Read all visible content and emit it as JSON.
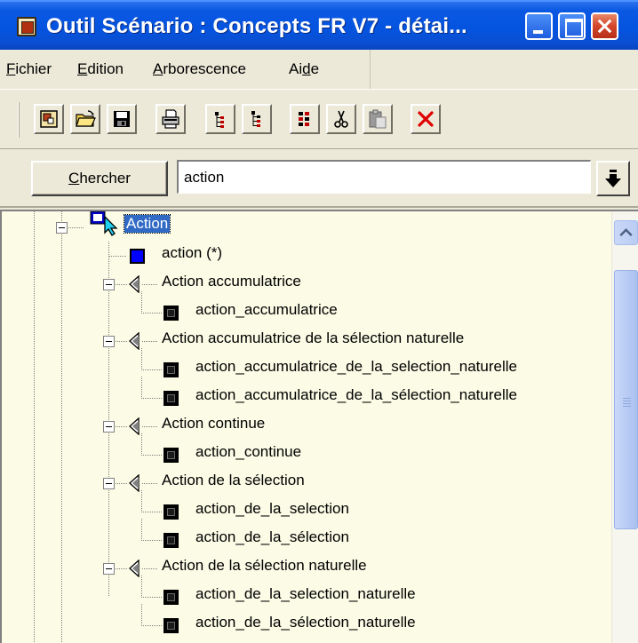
{
  "window": {
    "title": "Outil Scénario : Concepts FR V7 - détai..."
  },
  "menu": {
    "items": [
      {
        "prefix": "",
        "accel": "F",
        "rest": "ichier"
      },
      {
        "prefix": "",
        "accel": "E",
        "rest": "dition"
      },
      {
        "prefix": "",
        "accel": "A",
        "rest": "rborescence"
      },
      {
        "prefix": "Ai",
        "accel": "d",
        "rest": "e"
      }
    ]
  },
  "toolbar": {
    "icons": [
      "open-project-icon",
      "open-folder-icon",
      "save-icon",
      "print-icon",
      "expand-tree-icon",
      "collapse-tree-icon",
      "tree-options-icon",
      "cut-icon",
      "paste-icon",
      "delete-icon"
    ]
  },
  "search": {
    "button_accel": "C",
    "button_rest": "hercher",
    "value": "action"
  },
  "colors": {
    "selection": "#316ac5",
    "tree_background": "#fbfbe6",
    "delete_red": "#e00000"
  },
  "tree": {
    "root": "Action",
    "nodes": [
      {
        "label": "action (*)",
        "level": 1,
        "icon": "blue-square"
      },
      {
        "label": "Action accumulatrice",
        "level": 1,
        "icon": "arrow"
      },
      {
        "label": "action_accumulatrice",
        "level": 2,
        "icon": "black-square"
      },
      {
        "label": "Action accumulatrice de la sélection naturelle",
        "level": 1,
        "icon": "arrow"
      },
      {
        "label": "action_accumulatrice_de_la_selection_naturelle",
        "level": 2,
        "icon": "black-square"
      },
      {
        "label": "action_accumulatrice_de_la_sélection_naturelle",
        "level": 2,
        "icon": "black-square"
      },
      {
        "label": "Action continue",
        "level": 1,
        "icon": "arrow"
      },
      {
        "label": "action_continue",
        "level": 2,
        "icon": "black-square"
      },
      {
        "label": "Action de la sélection",
        "level": 1,
        "icon": "arrow"
      },
      {
        "label": "action_de_la_selection",
        "level": 2,
        "icon": "black-square"
      },
      {
        "label": "action_de_la_sélection",
        "level": 2,
        "icon": "black-square"
      },
      {
        "label": "Action de la sélection naturelle",
        "level": 1,
        "icon": "arrow"
      },
      {
        "label": "action_de_la_selection_naturelle",
        "level": 2,
        "icon": "black-square"
      },
      {
        "label": "action_de_la_sélection_naturelle",
        "level": 2,
        "icon": "black-square"
      }
    ]
  }
}
